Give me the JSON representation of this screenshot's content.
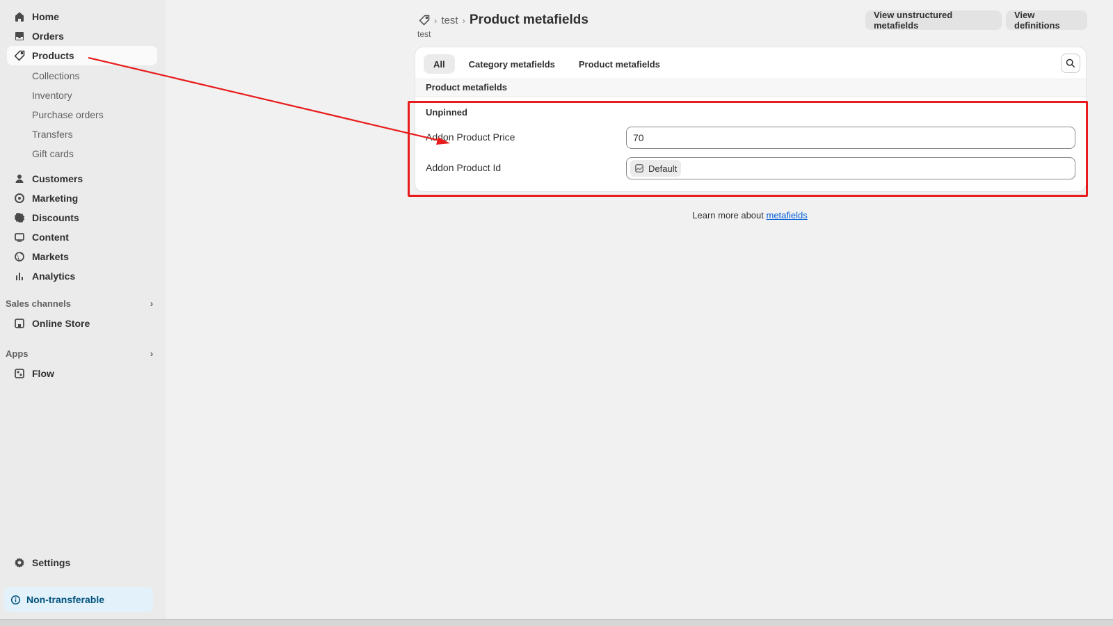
{
  "sidebar": {
    "home": "Home",
    "orders": "Orders",
    "products": "Products",
    "sub": [
      "Collections",
      "Inventory",
      "Purchase orders",
      "Transfers",
      "Gift cards"
    ],
    "customers": "Customers",
    "marketing": "Marketing",
    "discounts": "Discounts",
    "content": "Content",
    "markets": "Markets",
    "analytics": "Analytics",
    "sales_channels": "Sales channels",
    "online_store": "Online Store",
    "apps": "Apps",
    "flow": "Flow",
    "settings": "Settings",
    "non_transferable": "Non-transferable"
  },
  "header": {
    "breadcrumb_parent": "test",
    "title": "Product metafields",
    "subtitle": "test",
    "btn_unstructured": "View unstructured metafields",
    "btn_definitions": "View definitions"
  },
  "tabs": [
    "All",
    "Category metafields",
    "Product metafields"
  ],
  "card": {
    "group_heading": "Product metafields",
    "unpinned": "Unpinned",
    "fields": [
      {
        "label": "Addon Product Price",
        "value": "70"
      },
      {
        "label": "Addon Product Id",
        "value": "Default"
      }
    ]
  },
  "footer": {
    "learn_text": "Learn more about ",
    "learn_link": "metafields"
  },
  "colors": {
    "annotation": "#e81c1c",
    "link": "#005bd3"
  }
}
